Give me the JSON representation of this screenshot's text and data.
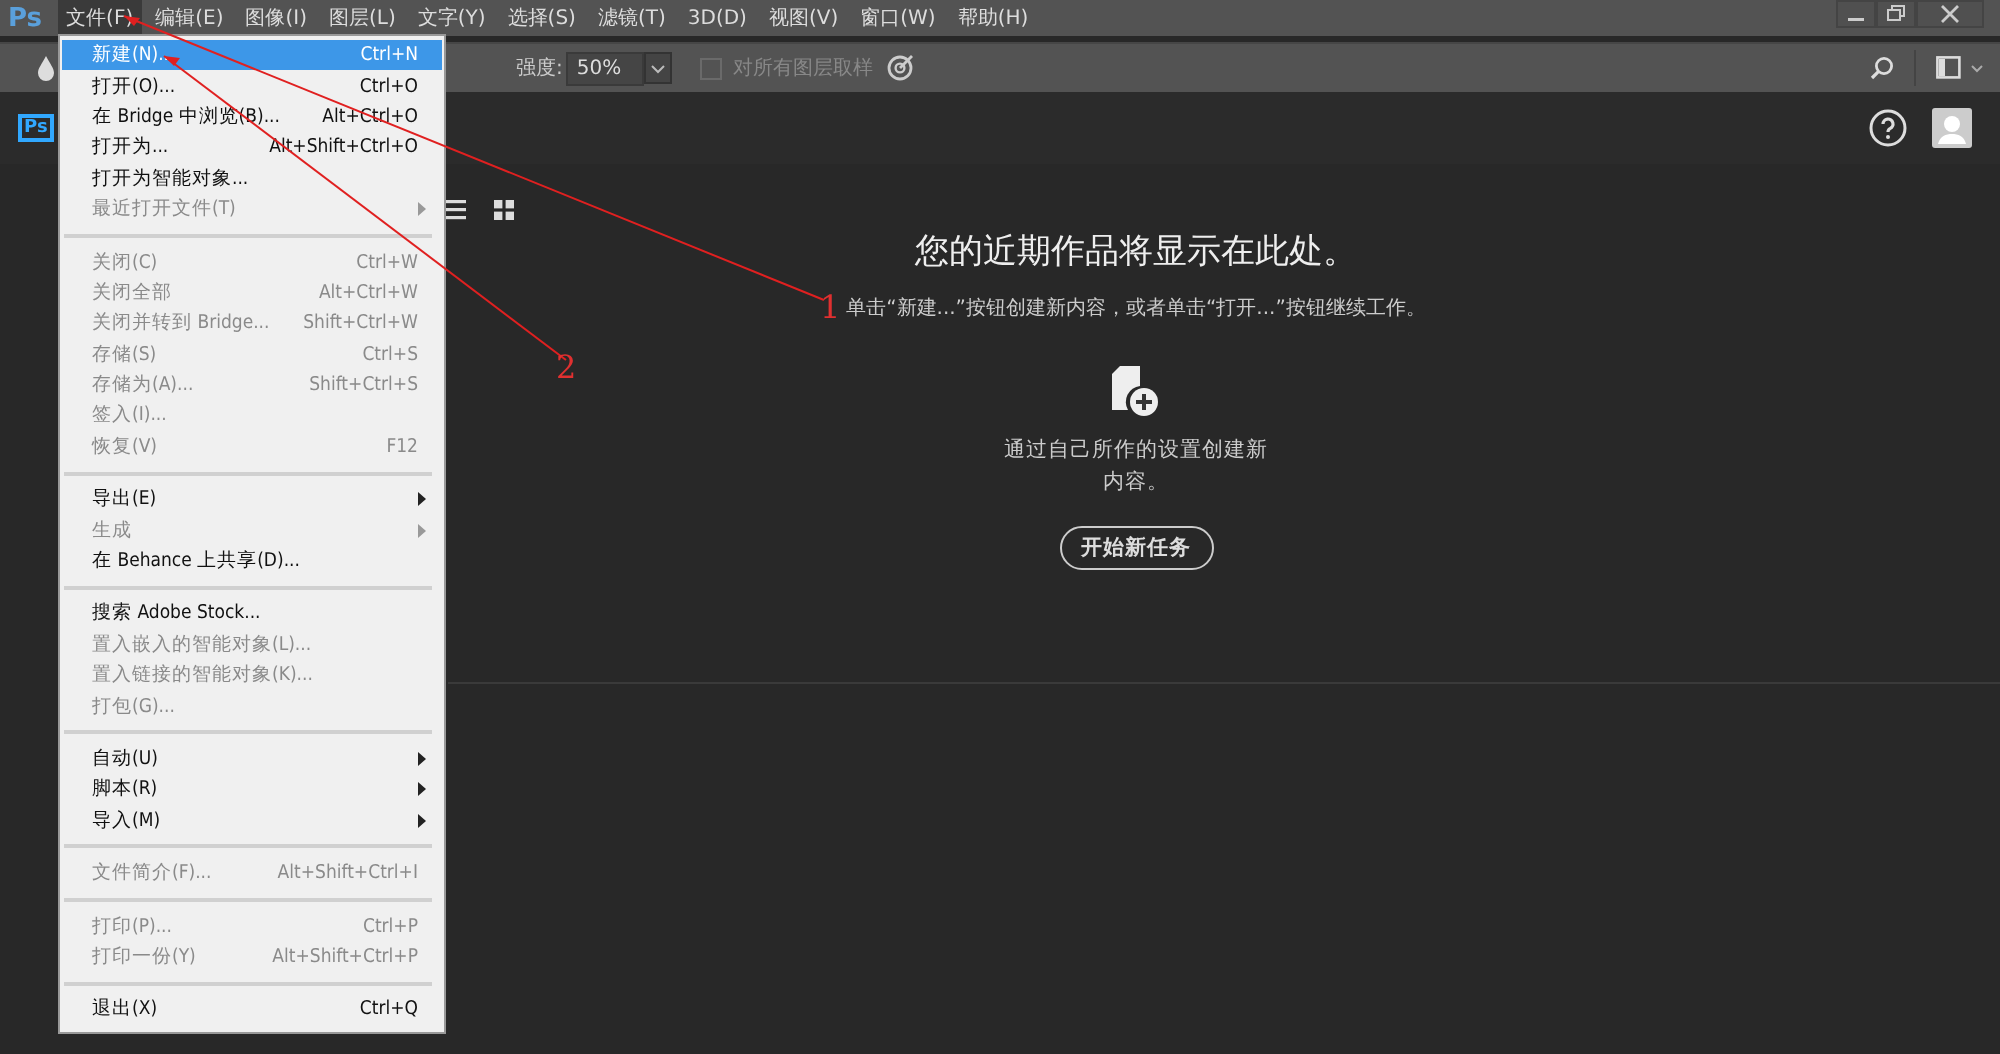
{
  "menubar": {
    "logo": "Ps",
    "items": [
      {
        "label": "文件(F)",
        "selected": true
      },
      {
        "label": "编辑(E)",
        "selected": false
      },
      {
        "label": "图像(I)",
        "selected": false
      },
      {
        "label": "图层(L)",
        "selected": false
      },
      {
        "label": "文字(Y)",
        "selected": false
      },
      {
        "label": "选择(S)",
        "selected": false
      },
      {
        "label": "滤镜(T)",
        "selected": false
      },
      {
        "label": "3D(D)",
        "selected": false
      },
      {
        "label": "视图(V)",
        "selected": false
      },
      {
        "label": "窗口(W)",
        "selected": false
      },
      {
        "label": "帮助(H)",
        "selected": false
      }
    ]
  },
  "options_bar": {
    "strength_label": "强度:",
    "strength_value": "50%",
    "sample_label": "对所有图层取样",
    "sample_checked": false
  },
  "home": {
    "logo": "Ps",
    "title": "您的近期作品将显示在此处。",
    "hint": "单击“新建...”按钮创建新内容，或者单击“打开...”按钮继续工作。",
    "new_text": "通过自己所作的设置创建新内容。",
    "start_button": "开始新任务"
  },
  "file_menu": [
    {
      "kind": "item",
      "label": "新建(N)...",
      "shortcut": "Ctrl+N",
      "disabled": false,
      "selected": true
    },
    {
      "kind": "item",
      "label": "打开(O)...",
      "shortcut": "Ctrl+O",
      "disabled": false,
      "selected": false
    },
    {
      "kind": "item",
      "label": "在 Bridge 中浏览(B)...",
      "shortcut": "Alt+Ctrl+O",
      "disabled": false,
      "selected": false
    },
    {
      "kind": "item",
      "label": "打开为...",
      "shortcut": "Alt+Shift+Ctrl+O",
      "disabled": false,
      "selected": false
    },
    {
      "kind": "item",
      "label": "打开为智能对象...",
      "disabled": false,
      "selected": false
    },
    {
      "kind": "submenu",
      "label": "最近打开文件(T)",
      "disabled": true,
      "selected": false
    },
    {
      "kind": "separator"
    },
    {
      "kind": "item",
      "label": "关闭(C)",
      "shortcut": "Ctrl+W",
      "disabled": true,
      "selected": false
    },
    {
      "kind": "item",
      "label": "关闭全部",
      "shortcut": "Alt+Ctrl+W",
      "disabled": true,
      "selected": false
    },
    {
      "kind": "item",
      "label": "关闭并转到 Bridge...",
      "shortcut": "Shift+Ctrl+W",
      "disabled": true,
      "selected": false
    },
    {
      "kind": "item",
      "label": "存储(S)",
      "shortcut": "Ctrl+S",
      "disabled": true,
      "selected": false
    },
    {
      "kind": "item",
      "label": "存储为(A)...",
      "shortcut": "Shift+Ctrl+S",
      "disabled": true,
      "selected": false
    },
    {
      "kind": "item",
      "label": "签入(I)...",
      "disabled": true,
      "selected": false
    },
    {
      "kind": "item",
      "label": "恢复(V)",
      "shortcut": "F12",
      "disabled": true,
      "selected": false
    },
    {
      "kind": "separator"
    },
    {
      "kind": "submenu",
      "label": "导出(E)",
      "disabled": false,
      "selected": false
    },
    {
      "kind": "submenu",
      "label": "生成",
      "disabled": true,
      "selected": false
    },
    {
      "kind": "item",
      "label": "在 Behance 上共享(D)...",
      "disabled": false,
      "selected": false
    },
    {
      "kind": "separator"
    },
    {
      "kind": "item",
      "label": "搜索 Adobe Stock...",
      "disabled": false,
      "selected": false
    },
    {
      "kind": "item",
      "label": "置入嵌入的智能对象(L)...",
      "disabled": true,
      "selected": false
    },
    {
      "kind": "item",
      "label": "置入链接的智能对象(K)...",
      "disabled": true,
      "selected": false
    },
    {
      "kind": "item",
      "label": "打包(G)...",
      "disabled": true,
      "selected": false
    },
    {
      "kind": "separator"
    },
    {
      "kind": "submenu",
      "label": "自动(U)",
      "disabled": false,
      "selected": false
    },
    {
      "kind": "submenu",
      "label": "脚本(R)",
      "disabled": false,
      "selected": false
    },
    {
      "kind": "submenu",
      "label": "导入(M)",
      "disabled": false,
      "selected": false
    },
    {
      "kind": "separator"
    },
    {
      "kind": "item",
      "label": "文件简介(F)...",
      "shortcut": "Alt+Shift+Ctrl+I",
      "disabled": true,
      "selected": false
    },
    {
      "kind": "separator"
    },
    {
      "kind": "item",
      "label": "打印(P)...",
      "shortcut": "Ctrl+P",
      "disabled": true,
      "selected": false
    },
    {
      "kind": "item",
      "label": "打印一份(Y)",
      "shortcut": "Alt+Shift+Ctrl+P",
      "disabled": true,
      "selected": false
    },
    {
      "kind": "separator"
    },
    {
      "kind": "item",
      "label": "退出(X)",
      "shortcut": "Ctrl+Q",
      "disabled": false,
      "selected": false
    }
  ],
  "annotations": [
    {
      "label": "1"
    },
    {
      "label": "2"
    }
  ]
}
